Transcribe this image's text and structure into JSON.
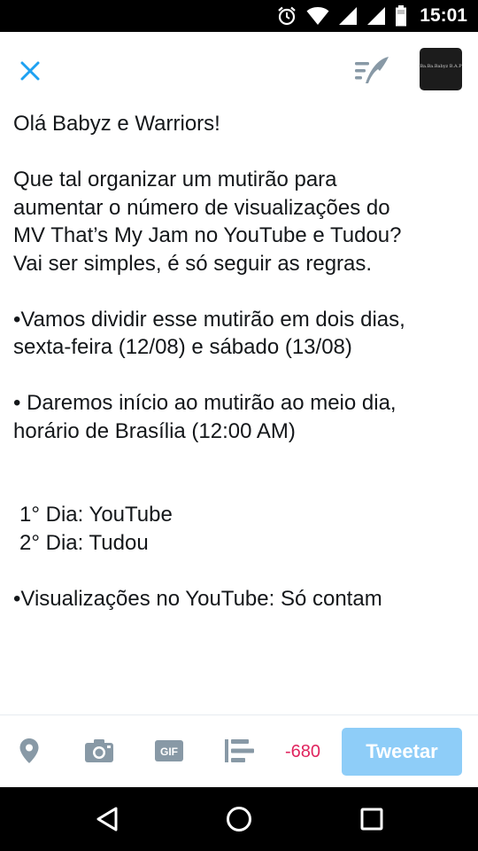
{
  "status_bar": {
    "time": "15:01",
    "icons": [
      "alarm-icon",
      "wifi-icon",
      "signal-icon",
      "signal-icon",
      "battery-icon"
    ]
  },
  "header": {
    "close_icon": "close-icon",
    "drafts_icon": "drafts-quill-icon",
    "avatar_text": "Ba.Ba.Babyz B.A.P"
  },
  "tweet": {
    "lines": [
      "Olá Babyz e Warriors!",
      "Que tal organizar um mutirão para",
      "aumentar o número de visualizações do",
      "MV That’s My Jam no YouTube e Tudou?",
      "Vai ser simples, é só seguir as regras.",
      "•Vamos dividir esse mutirão em dois dias,",
      "sexta-feira (12/08) e sábado (13/08)",
      "• Daremos início ao mutirão ao meio dia,",
      "horário de Brasília (12:00 AM)",
      "1° Dia: YouTube",
      "2° Dia: Tudou",
      "•Visualizações no YouTube: Só contam"
    ]
  },
  "toolbar": {
    "icons": [
      "location-icon",
      "camera-icon",
      "gif-icon",
      "poll-icon"
    ],
    "gif_label": "GIF",
    "char_count": "-680",
    "tweet_label": "Tweetar"
  },
  "nav_bar": {
    "icons": [
      "back-icon",
      "home-icon",
      "recents-icon"
    ]
  },
  "colors": {
    "accent": "#1da1f2",
    "tweet_button": "#8ecdf8",
    "char_count": "#e0245e",
    "icon_gray": "#8899a6"
  }
}
